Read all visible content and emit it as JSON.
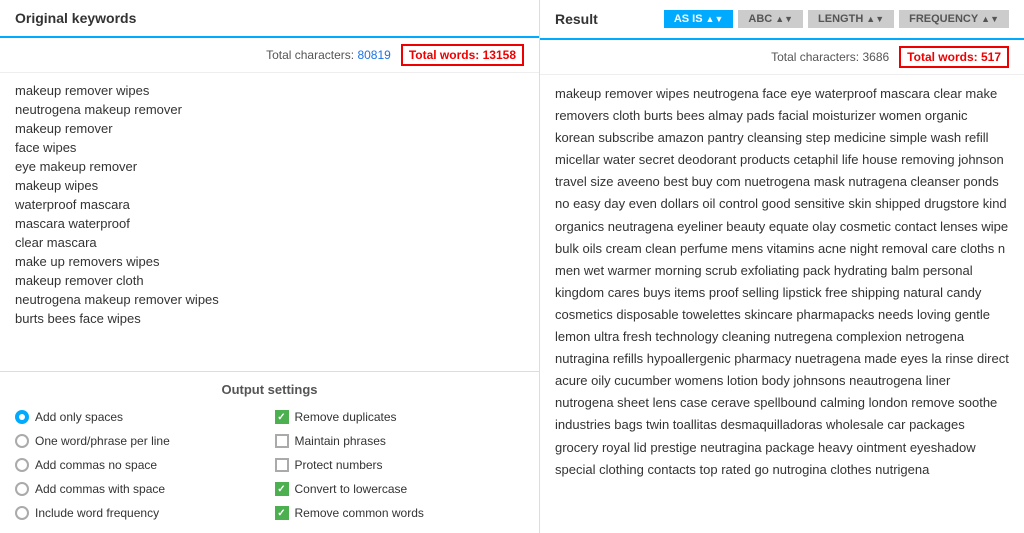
{
  "left_panel": {
    "title": "Original keywords",
    "stats": {
      "total_chars_label": "Total characters:",
      "total_chars_value": "80819",
      "total_words_label": "Total words:",
      "total_words_value": "13158"
    },
    "keywords": [
      "makeup remover wipes",
      "neutrogena makeup remover",
      "makeup remover",
      "face wipes",
      "eye makeup remover",
      "makeup wipes",
      "waterproof mascara",
      "mascara waterproof",
      "clear mascara",
      "make up removers wipes",
      "makeup remover cloth",
      "neutrogena makeup remover wipes",
      "burts bees face wipes"
    ],
    "output_settings": {
      "title": "Output settings",
      "left_options": [
        {
          "type": "radio",
          "checked": true,
          "label": "Add only spaces"
        },
        {
          "type": "radio",
          "checked": false,
          "label": "One word/phrase per line"
        },
        {
          "type": "radio",
          "checked": false,
          "label": "Add commas no space"
        },
        {
          "type": "radio",
          "checked": false,
          "label": "Add commas with space"
        },
        {
          "type": "radio",
          "checked": false,
          "label": "Include word frequency"
        }
      ],
      "right_options": [
        {
          "type": "checkbox",
          "checked": true,
          "label": "Remove duplicates"
        },
        {
          "type": "checkbox",
          "checked": false,
          "label": "Maintain phrases"
        },
        {
          "type": "checkbox",
          "checked": false,
          "label": "Protect numbers"
        },
        {
          "type": "checkbox",
          "checked": true,
          "label": "Convert to lowercase"
        },
        {
          "type": "checkbox",
          "checked": true,
          "label": "Remove common words"
        }
      ]
    }
  },
  "right_panel": {
    "title": "Result",
    "sort_buttons": [
      {
        "label": "AS IS",
        "active": true
      },
      {
        "label": "ABC",
        "active": false
      },
      {
        "label": "LENGTH",
        "active": false
      },
      {
        "label": "FREQUENCY",
        "active": false
      }
    ],
    "stats": {
      "total_chars_label": "Total characters:",
      "total_chars_value": "3686",
      "total_words_label": "Total words:",
      "total_words_value": "517"
    },
    "result_text": "makeup remover wipes neutrogena face eye waterproof mascara clear make removers cloth burts bees almay pads facial moisturizer women organic korean subscribe amazon pantry cleansing step medicine simple wash refill micellar water secret deodorant products cetaphil life house removing johnson travel size aveeno best buy com nuetrogena mask nutragena cleanser ponds no easy day even dollars oil control good sensitive skin shipped drugstore kind organics neutragena eyeliner beauty equate olay cosmetic contact lenses wipe bulk oils cream clean perfume mens vitamins acne night removal care cloths n men wet warmer morning scrub exfoliating pack hydrating balm personal kingdom cares buys items proof selling lipstick free shipping natural candy cosmetics disposable towelettes skincare pharmapacks needs loving gentle lemon ultra fresh technology cleaning nutregena complexion netrogena nutragina refills hypoallergenic pharmacy nuetragena made eyes la rinse direct acure oily cucumber womens lotion body johnsons neautrogena liner nutrogena sheet lens case cerave spellbound calming london remove soothe industries bags twin toallitas desmaquilladoras wholesale car packages grocery royal lid prestige neutragina package heavy ointment eyeshadow special clothing contacts top rated go nutrogina clothes nutrigena"
  }
}
